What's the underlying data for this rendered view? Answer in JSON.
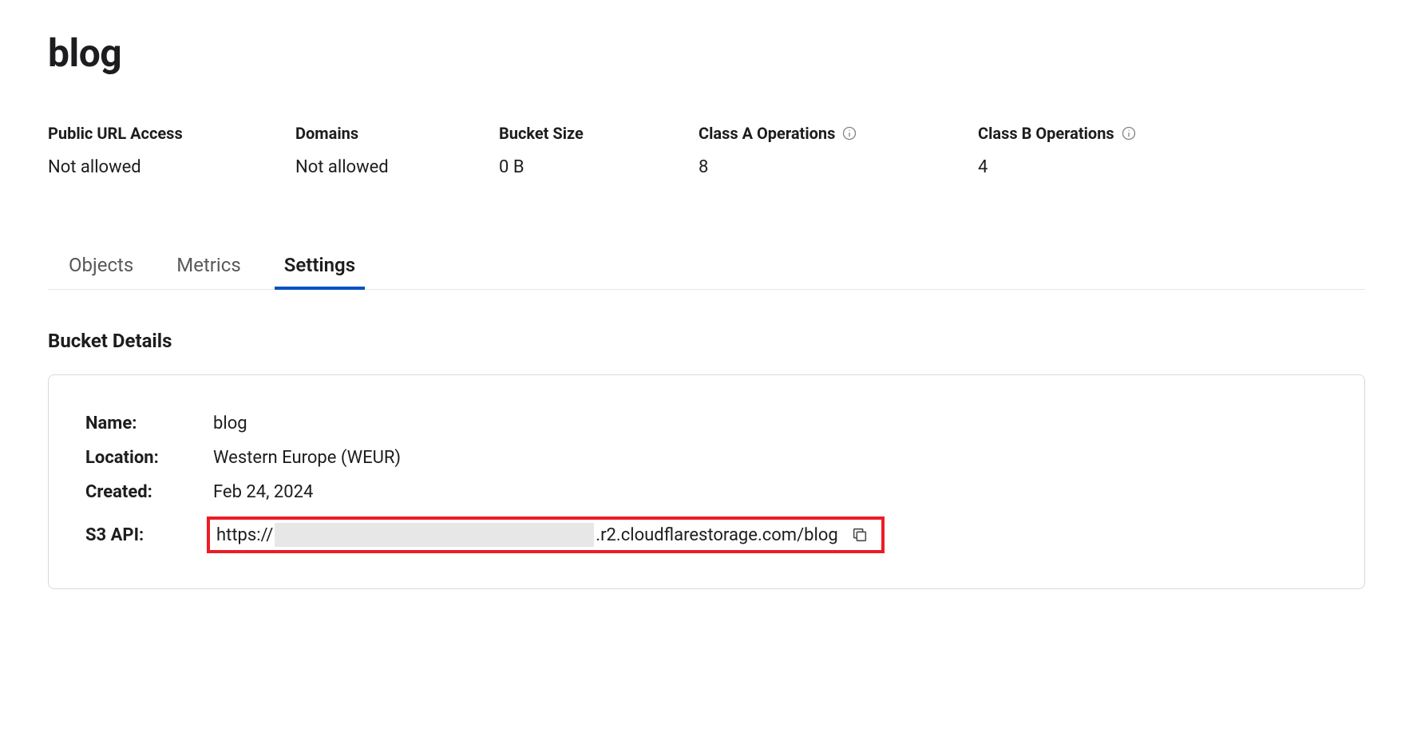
{
  "title": "blog",
  "stats": {
    "public_url_access": {
      "label": "Public URL Access",
      "value": "Not allowed"
    },
    "domains": {
      "label": "Domains",
      "value": "Not allowed"
    },
    "bucket_size": {
      "label": "Bucket Size",
      "value": "0 B"
    },
    "class_a_ops": {
      "label": "Class A Operations",
      "value": "8"
    },
    "class_b_ops": {
      "label": "Class B Operations",
      "value": "4"
    }
  },
  "tabs": {
    "objects": "Objects",
    "metrics": "Metrics",
    "settings": "Settings"
  },
  "active_tab": "settings",
  "section_title": "Bucket Details",
  "details": {
    "name": {
      "label": "Name:",
      "value": "blog"
    },
    "location": {
      "label": "Location:",
      "value": "Western Europe (WEUR)"
    },
    "created": {
      "label": "Created:",
      "value": "Feb 24, 2024"
    },
    "s3_api": {
      "label": "S3 API:",
      "prefix": "https://",
      "suffix": ".r2.cloudflarestorage.com/blog"
    }
  }
}
